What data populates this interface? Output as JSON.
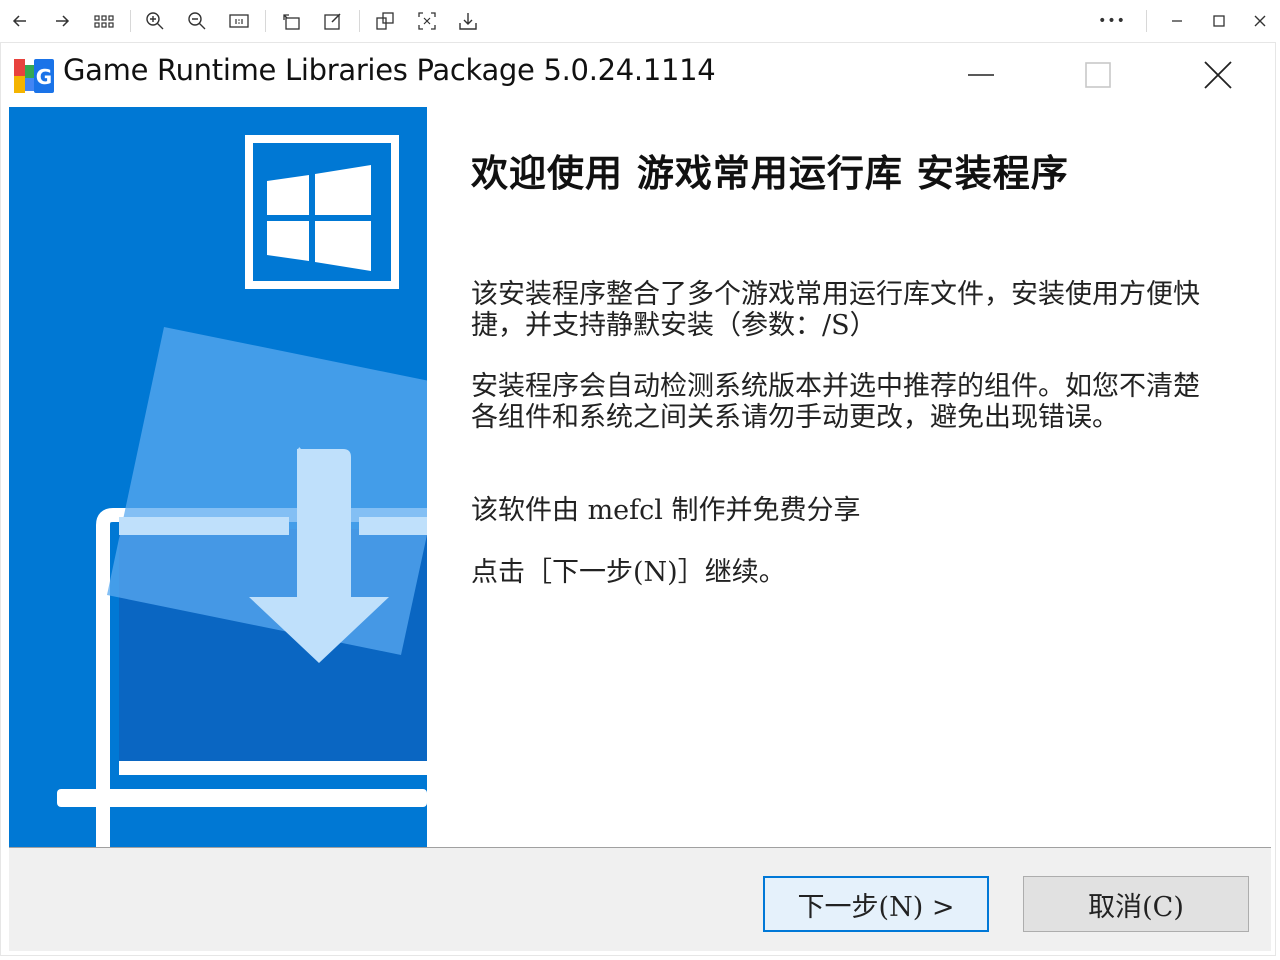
{
  "viewer": {
    "icons": [
      "back-arrow-icon",
      "forward-arrow-icon",
      "grid-view-icon",
      "zoom-in-icon",
      "zoom-out-icon",
      "actual-size-icon",
      "rotate-icon",
      "edit-icon",
      "copy-icon",
      "crop-icon",
      "save-icon"
    ],
    "more_label": "•••"
  },
  "window": {
    "title": "Game Runtime Libraries Package 5.0.24.1114"
  },
  "content": {
    "heading": "欢迎使用 游戏常用运行库 安装程序",
    "para1": "该安装程序整合了多个游戏常用运行库文件，安装使用方便快捷，并支持静默安装（参数：/S）",
    "para2": "安装程序会自动检测系统版本并选中推荐的组件。如您不清楚各组件和系统之间关系请勿手动更改，避免出现错误。",
    "para3": "该软件由 mefcl 制作并免费分享",
    "para4": "点击［下一步(N)］继续。"
  },
  "buttons": {
    "next": "下一步(N) >",
    "cancel": "取消(C)"
  },
  "colors": {
    "side_panel": "#0078d4",
    "accent": "#0078d7"
  }
}
